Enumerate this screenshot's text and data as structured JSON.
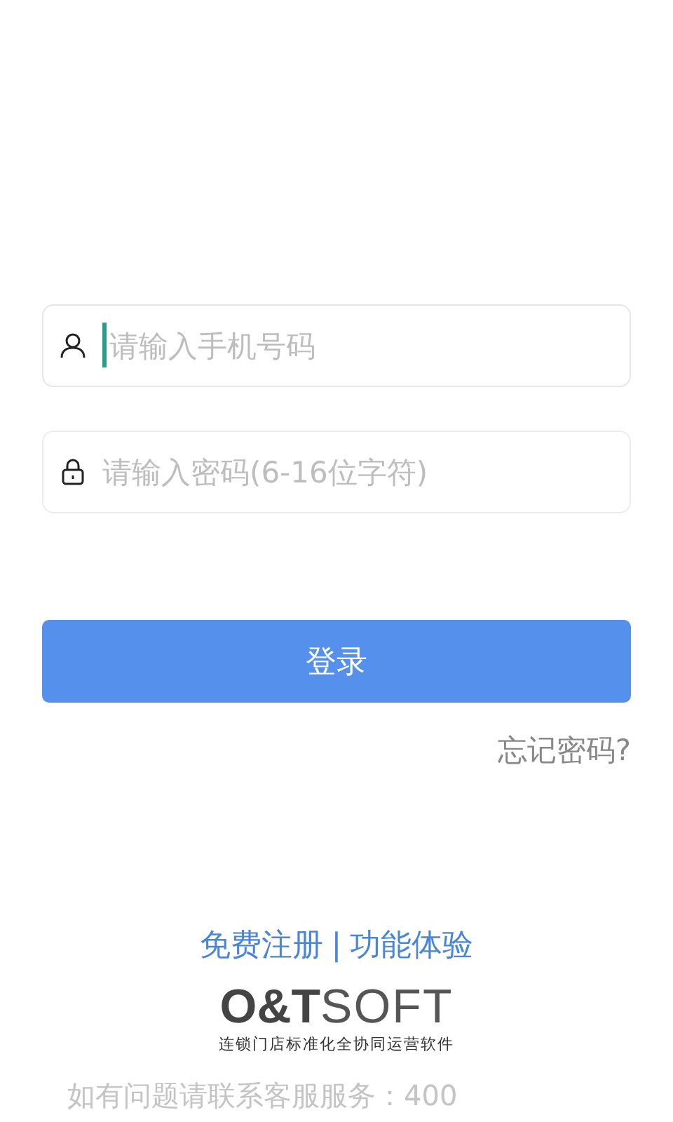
{
  "fields": [
    {
      "kind": "user",
      "placeholder": "请输入手机号码",
      "focused": true
    },
    {
      "kind": "lock",
      "placeholder": "请输入密码(6-16位字符)",
      "focused": false
    }
  ],
  "login_button": "登录",
  "forgot_link": "忘记密码?",
  "links": [
    {
      "label": "免费注册"
    },
    {
      "label": "功能体验"
    }
  ],
  "link_separator": "|",
  "logo": {
    "mark": "O&T",
    "word": "SOFT",
    "tagline": "连锁门店标准化全协同运营软件"
  },
  "footer": "如有问题请联系客服服务：400"
}
